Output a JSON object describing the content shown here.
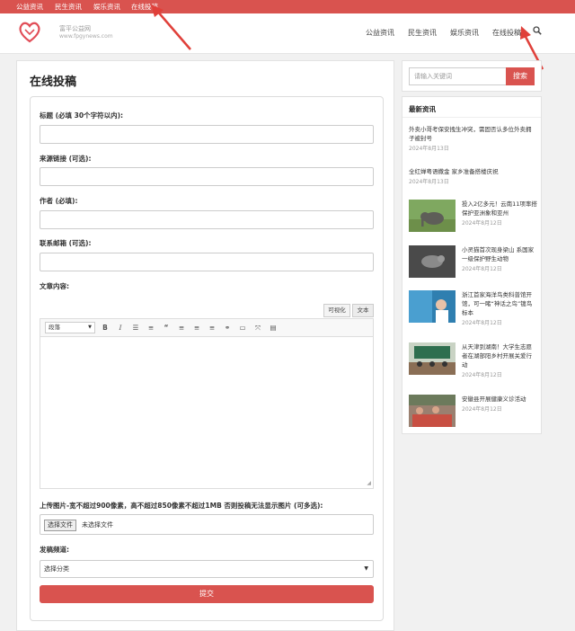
{
  "topbar": {
    "links": [
      "公益资讯",
      "民生资讯",
      "娱乐资讯",
      "在线投稿"
    ]
  },
  "header": {
    "site_name": "富平公益网",
    "site_url": "www.fpgynews.com",
    "logo_subtext": "富平公益网",
    "nav": [
      "公益资讯",
      "民生资讯",
      "娱乐资讯",
      "在线投稿"
    ]
  },
  "main": {
    "title": "在线投稿",
    "form": {
      "title_label": "标题 (必填 30个字符以内):",
      "source_label": "来源链接 (可选):",
      "author_label": "作者 (必填):",
      "email_label": "联系邮箱 (可选):",
      "content_label": "文章内容:",
      "editor_tabs": [
        "可视化",
        "文本"
      ],
      "format_select": "段落",
      "toolbar_icons": [
        "bold-icon",
        "italic-icon",
        "bulleted-list-icon",
        "numbered-list-icon",
        "blockquote-icon",
        "align-left-icon",
        "align-center-icon",
        "align-right-icon",
        "link-icon",
        "more-tag-icon",
        "fullscreen-icon",
        "toolbar-toggle-icon"
      ],
      "upload_label": "上传图片-宽不超过900像素，高不超过850像素不超过1MB 否则投稿无法显示图片 (可多选):",
      "file_button": "选择文件",
      "file_status": "未选择文件",
      "channel_label": "发稿频道:",
      "channel_selected": "选择分类",
      "submit": "提交"
    }
  },
  "sidebar": {
    "search_placeholder": "请输入关键词",
    "search_button": "搜索",
    "news_title": "最新资讯",
    "news": [
      {
        "title": "外卖小哥考保安拽生冲突，需固否认多位外卖拥子被封号",
        "date": "2024年8月13日"
      },
      {
        "title": "全红婵粤语撒金 家乡准备搭楼庆祝",
        "date": "2024年8月13日"
      },
      {
        "title": "投入2亿多元！云南11项率搭保护亚洲象和亚州",
        "date": "2024年8月12日"
      },
      {
        "title": "小灵猫首次现身梁山 系国家一级保护野生动物",
        "date": "2024年8月12日"
      },
      {
        "title": "浙江首家海洋鸟类科普馆开馆，可一睹“神话之鸟”镀鸟标本",
        "date": "2024年8月12日"
      },
      {
        "title": "从天津到湖南！大学生志愿者在湖部阳乡村开展关爱行动",
        "date": "2024年8月12日"
      },
      {
        "title": "安徽县开展健康义诊活动",
        "date": "2024年8月12日"
      }
    ]
  },
  "colors": {
    "accent": "#d9534f",
    "annotation_arrow": "#e0403a"
  }
}
